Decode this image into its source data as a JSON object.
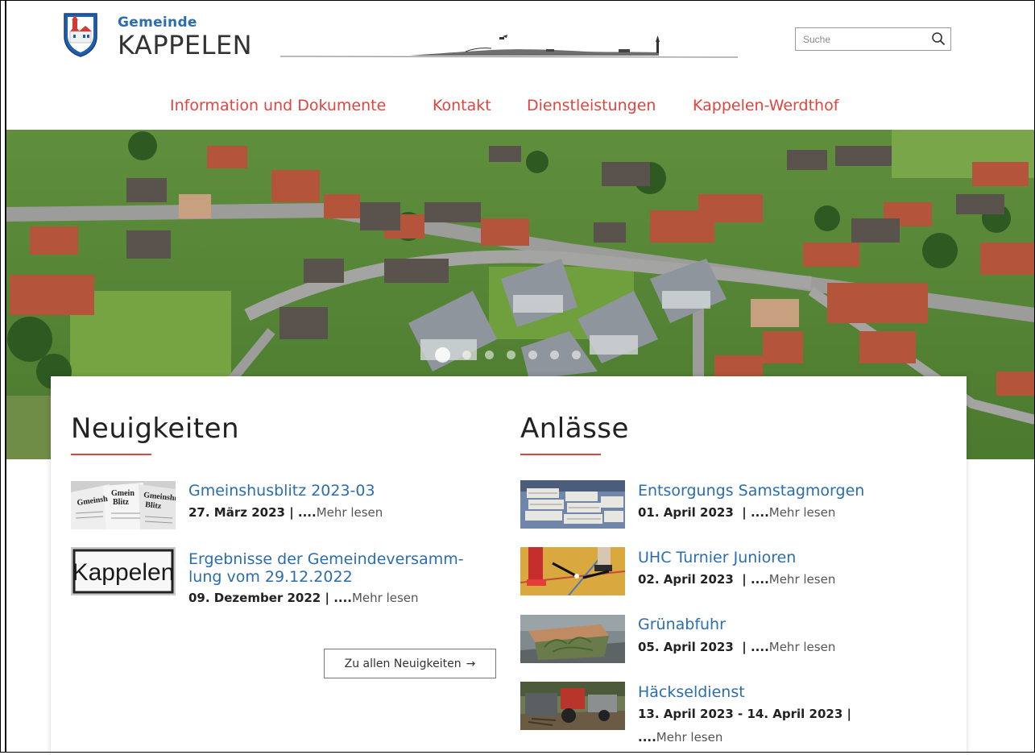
{
  "header": {
    "brand_small": "Gemeinde",
    "brand_big": "KAPPELEN",
    "search": {
      "placeholder": "Suche"
    }
  },
  "nav": {
    "items": [
      {
        "label": "Information und Dokumente"
      },
      {
        "label": "Kontakt"
      },
      {
        "label": "Dienstleistungen"
      },
      {
        "label": "Kappelen-Werdthof"
      }
    ]
  },
  "hero": {
    "slides_total": 7,
    "active_slide": 1
  },
  "news": {
    "title": "Neuigkeiten",
    "items": [
      {
        "title": "Gmeinshusblitz 2023-03",
        "date": "27. März 2023",
        "sep": "|",
        "dots": "....",
        "more": "Mehr lesen",
        "thumb": "newspaper"
      },
      {
        "title_line1": "Ergebnisse der Gemeindeversamm-",
        "title_line2": "lung vom 29.12.2022",
        "date": "09. Dezember 2022",
        "sep": "|",
        "dots": "....",
        "more": "Mehr lesen",
        "thumb": "kappelen-sign",
        "thumb_text": "Kappelen"
      }
    ],
    "all_button": "Zu allen Neuigkeiten",
    "all_button_arrow": "→"
  },
  "events": {
    "title": "Anlässe",
    "items": [
      {
        "title": "Entsorgungs Samstagmorgen",
        "date": "01. April 2023",
        "sep": "|",
        "dots": "....",
        "more": "Mehr lesen",
        "thumb": "paper-bundles"
      },
      {
        "title": "UHC Turnier Junioren",
        "date": "02. April 2023",
        "sep": "|",
        "dots": "....",
        "more": "Mehr lesen",
        "thumb": "floorball"
      },
      {
        "title": "Grünabfuhr",
        "date": "05. April 2023",
        "sep": "|",
        "dots": "....",
        "more": "Mehr lesen",
        "thumb": "green-bin"
      },
      {
        "title": "Häckseldienst",
        "date": "13. April 2023 - 14. April 2023",
        "sep": "|",
        "dots": "....",
        "more": "Mehr lesen",
        "thumb": "tractor-shredder"
      }
    ]
  },
  "colors": {
    "accent_red": "#e0443f",
    "link_blue": "#2a6db0"
  }
}
